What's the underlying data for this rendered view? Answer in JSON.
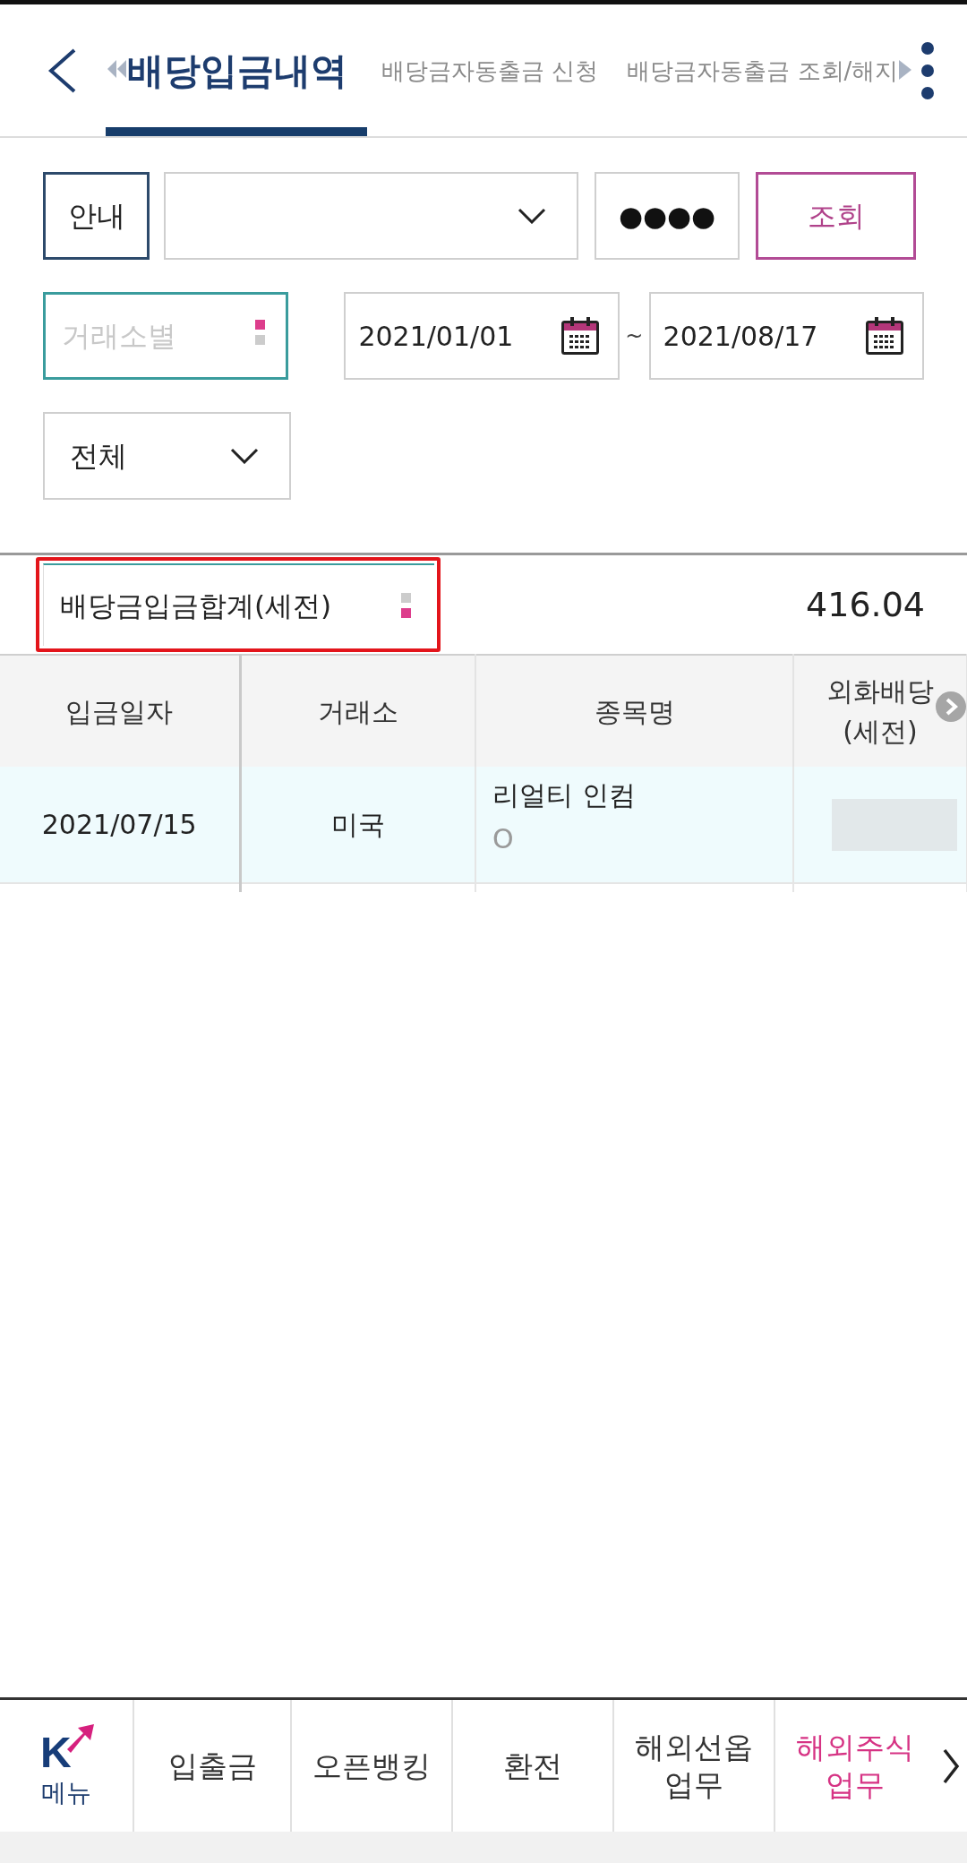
{
  "tabs": [
    {
      "label": "배당입금내역",
      "selected": true
    },
    {
      "label": "배당금자동출금 신청",
      "selected": false
    },
    {
      "label": "배당금자동출금 조회/해지",
      "selected": false
    }
  ],
  "filters": {
    "guide_button": "안내",
    "password": {
      "value": "●●●●"
    },
    "search_button": "조회",
    "exchange": {
      "placeholder": "거래소별",
      "dots": [
        {
          "selected": true
        },
        {
          "selected": false
        }
      ]
    },
    "date_from": "2021/01/01",
    "range_separator": "~",
    "date_to": "2021/08/17",
    "type_select": {
      "value": "전체"
    }
  },
  "summary": {
    "label": "배당금입금합계(세전)",
    "dots": [
      {
        "selected": false
      },
      {
        "selected": true
      }
    ],
    "highlighted": true,
    "value": "416.04"
  },
  "table": {
    "columns": [
      "입금일자",
      "거래소",
      "종목명",
      "외화배당\n(세전)"
    ],
    "rows": [
      {
        "date": "2021/07/15",
        "exchange": "미국",
        "stock_name": "리얼티 인컴",
        "stock_code": "O",
        "amount_masked": true
      }
    ]
  },
  "bottom_nav": {
    "menu": {
      "logo": "K",
      "label": "메뉴"
    },
    "items": [
      {
        "label": "입출금",
        "selected": false
      },
      {
        "label": "오픈뱅킹",
        "selected": false
      },
      {
        "label": "환전",
        "selected": false
      },
      {
        "label": "해외선옵\n업무",
        "selected": false
      },
      {
        "label": "해외주식\n업무",
        "selected": true
      }
    ]
  }
}
